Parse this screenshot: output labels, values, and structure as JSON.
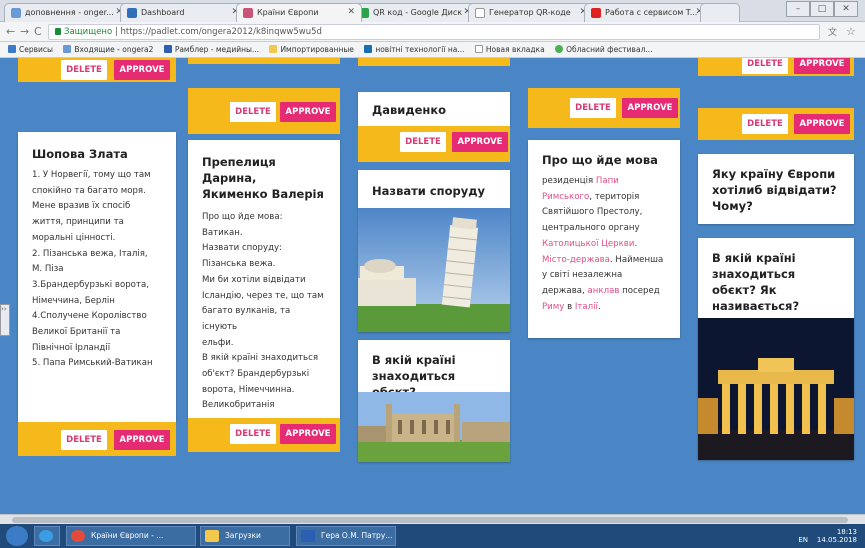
{
  "tabs": [
    {
      "label": "доповнення - onger..."
    },
    {
      "label": "Dashboard"
    },
    {
      "label": "Країни Європи"
    },
    {
      "label": "QR код - Google Диск"
    },
    {
      "label": "Генератор QR-коде"
    },
    {
      "label": "Работа с сервисом T..."
    }
  ],
  "address": {
    "secure": "Защищено",
    "url": "https://padlet.com/ongera2012/k8inqww5wu5d"
  },
  "bookmarks": [
    "Сервисы",
    "Входящие - ongera2",
    "Рамблер - медийны...",
    "Импортированные",
    "новітні технології на...",
    "Новая вкладка",
    "Обласний фестивал..."
  ],
  "buttons": {
    "delete": "DELETE",
    "approve": "APPROVE"
  },
  "cards": {
    "c1": {
      "title": "Шопова Злата",
      "lines": [
        "1. У Норвегії, тому що там",
        "спокійно та багато моря.",
        "Мене вразив їх спосіб",
        "життя, принципи та",
        "моральні цінності.",
        "2. Пізанська вежа, Італія,",
        "М. Піза",
        "3.Брандербурзькі ворота,",
        "Німеччина, Берлін",
        "4.Сполучене Королівство",
        "Великої Британії та",
        "Північної Ірландії",
        "5. Папа Римський-Ватикан"
      ]
    },
    "c2": {
      "title_lines": [
        "Препелиця Дарина,",
        "Якименко Валерія"
      ],
      "lines": [
        "Про що йде мова:",
        "Ватикан.",
        "Назвати споруду:",
        "Пізанська вежа.",
        "Ми би хотіли відвідати",
        "Ісландію, через те, що там",
        "багато вулканів, та існують",
        "ельфи.",
        "В якій країні знаходиться",
        "об'єкт? Брандербурзькі",
        "ворота, Німеччинна.",
        "Великобританія"
      ]
    },
    "c3a": {
      "title": "Давиденко"
    },
    "c3b": {
      "title": "Назвати споруду"
    },
    "c3c": {
      "title_lines": [
        "В якій країні",
        "знаходиться обєкт?"
      ]
    },
    "c4": {
      "title": "Про що йде мова",
      "segments": [
        [
          {
            "t": "резиденція ",
            "p": false
          },
          {
            "t": "Папи",
            "p": true
          }
        ],
        [
          {
            "t": "Римського",
            "p": true
          },
          {
            "t": ", територія",
            "p": false
          }
        ],
        [
          {
            "t": "Святійшого Престолу,",
            "p": false
          }
        ],
        [
          {
            "t": "центрального органу",
            "p": false
          }
        ],
        [
          {
            "t": "Католицької Церкви",
            "p": true
          },
          {
            "t": ".",
            "p": false
          }
        ],
        [
          {
            "t": "Місто-держава",
            "p": true
          },
          {
            "t": ". Найменша",
            "p": false
          }
        ],
        [
          {
            "t": "у світі незалежна",
            "p": false
          }
        ],
        [
          {
            "t": "держава, ",
            "p": false
          },
          {
            "t": "анклав",
            "p": true
          },
          {
            "t": " посеред",
            "p": false
          }
        ],
        [
          {
            "t": "Риму",
            "p": true
          },
          {
            "t": " в ",
            "p": false
          },
          {
            "t": "Італії",
            "p": true
          },
          {
            "t": ".",
            "p": false
          }
        ]
      ]
    },
    "c5a": {
      "title_lines": [
        "Яку країну Європи",
        "хотілиб відвідати?",
        "Чому?"
      ]
    },
    "c5b": {
      "title_lines": [
        "В якій країні",
        "знаходиться обєкт? Як",
        "називається?"
      ]
    }
  },
  "fab": "+",
  "taskbar": [
    "Країни Європи - ...",
    "Загрузки",
    "Гера О.М. Патру..."
  ],
  "tray": {
    "lang": "EN",
    "time": "18:13",
    "date": "14.05.2018"
  },
  "colors": {
    "background": "#4a86c5",
    "bar": "#f6b91c",
    "approve": "#e52b73",
    "link": "#e24f87"
  }
}
